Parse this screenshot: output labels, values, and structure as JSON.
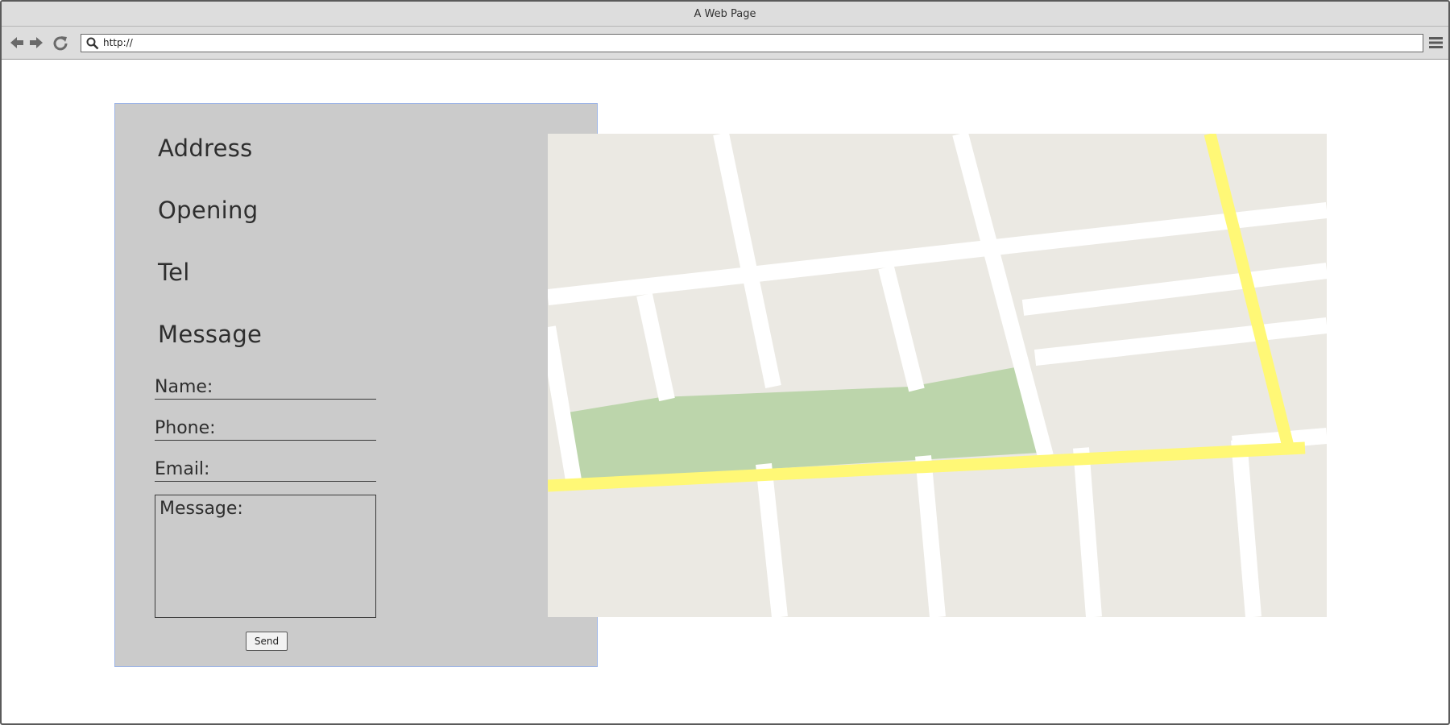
{
  "window": {
    "title": "A Web Page"
  },
  "toolbar": {
    "url": "http://",
    "back_icon": "back-arrow-icon",
    "forward_icon": "forward-arrow-icon",
    "reload_icon": "reload-icon",
    "search_icon": "search-icon",
    "menu_icon": "hamburger-menu-icon"
  },
  "contact": {
    "headings": [
      "Address",
      "Opening",
      "Tel",
      "Message"
    ],
    "form": {
      "name_label": "Name:",
      "phone_label": "Phone:",
      "email_label": "Email:",
      "message_label": "Message:",
      "send_label": "Send"
    }
  },
  "map": {
    "colors": {
      "land": "#ebe9e3",
      "street": "#ffffff",
      "highway": "#fff876",
      "park": "#bcd5ab"
    }
  },
  "colors": {
    "chrome": "#dddddd",
    "panel": "#cbcbcb",
    "panel_border": "#9cb4e6",
    "text": "#2e2e2e"
  }
}
